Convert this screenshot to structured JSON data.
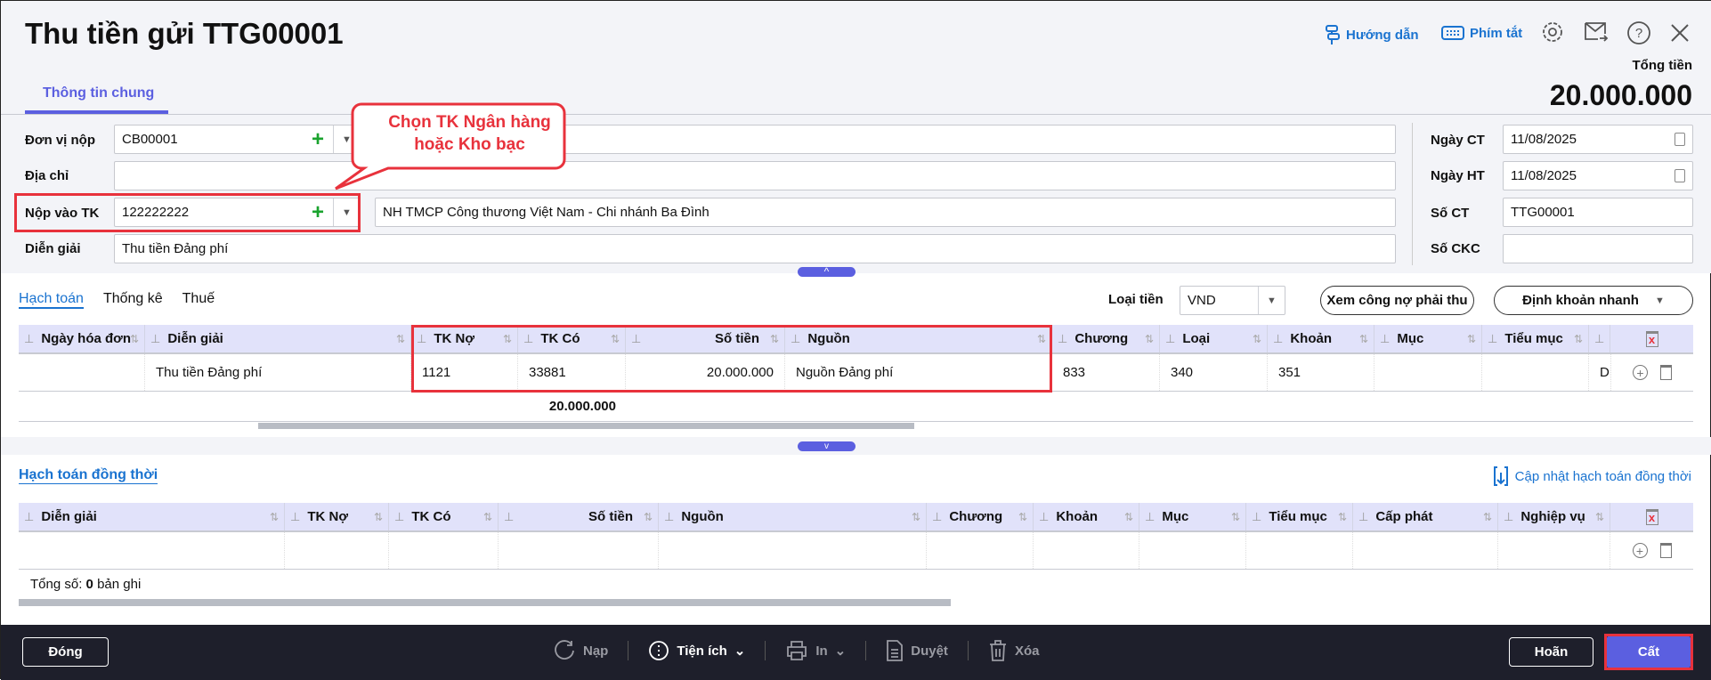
{
  "header": {
    "title": "Thu tiền gửi TTG00001",
    "tab": "Thông tin chung",
    "guide": "Hướng dẫn",
    "shortcuts": "Phím tắt",
    "total_label": "Tổng tiền",
    "total_value": "20.000.000"
  },
  "form": {
    "don_vi_nop_label": "Đơn vị nộp",
    "don_vi_nop": "CB00001",
    "dia_chi_label": "Địa chỉ",
    "dia_chi": "",
    "nop_vao_tk_label": "Nộp vào TK",
    "nop_vao_tk": "122222222",
    "bank_name": "NH TMCP Công thương Việt Nam - Chi nhánh  Ba Đình",
    "dien_giai_label": "Diễn giải",
    "dien_giai": "Thu tiền Đảng phí",
    "ngay_ct_label": "Ngày CT",
    "ngay_ct": "11/08/2025",
    "ngay_ht_label": "Ngày HT",
    "ngay_ht": "11/08/2025",
    "so_ct_label": "Số CT",
    "so_ct": "TTG00001",
    "so_ckc_label": "Số CKC",
    "so_ckc": ""
  },
  "callout": {
    "line1": "Chọn TK Ngân hàng",
    "line2": "hoặc Kho bạc"
  },
  "detail": {
    "tabs": [
      "Hạch toán",
      "Thống kê",
      "Thuế"
    ],
    "currency_label": "Loại tiền",
    "currency": "VND",
    "view_debt": "Xem công nợ phải thu",
    "quick_entry": "Định khoản nhanh",
    "columns": [
      "Ngày hóa đơn",
      "Diễn giải",
      "TK Nợ",
      "TK Có",
      "Số tiền",
      "Nguồn",
      "Chương",
      "Loại",
      "Khoản",
      "Mục",
      "Tiểu mục",
      ""
    ],
    "rows": [
      [
        "",
        "Thu tiền Đảng phí",
        "1121",
        "33881",
        "20.000.000",
        "Nguồn Đảng phí",
        "833",
        "340",
        "351",
        "",
        "",
        "D"
      ]
    ],
    "total": "20.000.000"
  },
  "concurrent": {
    "title": "Hạch toán đồng thời",
    "update": "Cập nhật hạch toán đồng thời",
    "columns": [
      "Diễn giải",
      "TK Nợ",
      "TK Có",
      "Số tiền",
      "Nguồn",
      "Chương",
      "Khoản",
      "Mục",
      "Tiểu mục",
      "Cấp phát",
      "Nghiệp vụ"
    ],
    "count_prefix": "Tổng số:",
    "count": "0",
    "count_suffix": "bản ghi"
  },
  "footer": {
    "close": "Đóng",
    "reload": "Nạp",
    "utilities": "Tiện ích",
    "print": "In",
    "approve": "Duyệt",
    "delete": "Xóa",
    "defer": "Hoãn",
    "save": "Cất"
  },
  "colors": {
    "accent": "#5b5fe0",
    "link": "#1a73d0",
    "highlight": "#e8323c",
    "footer": "#1e1f2b"
  }
}
